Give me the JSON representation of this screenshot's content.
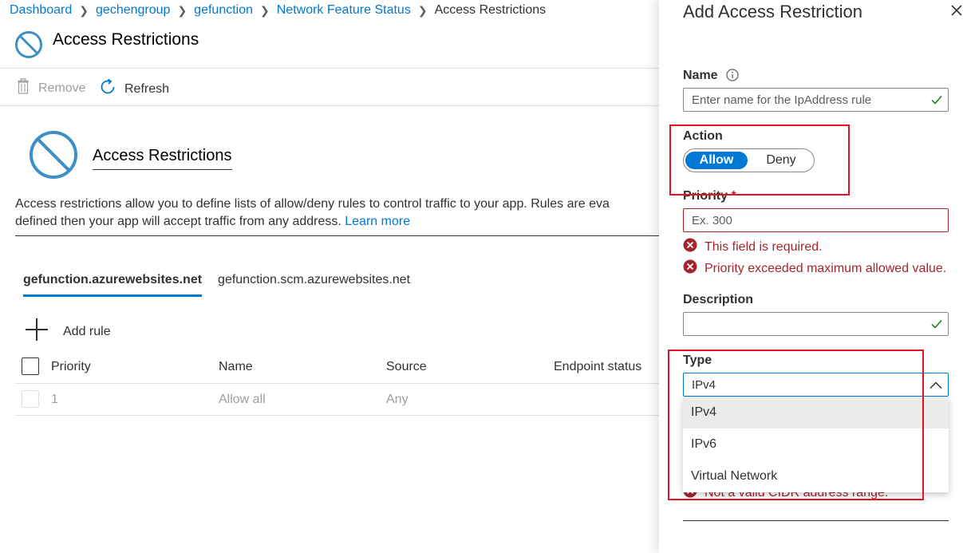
{
  "breadcrumb": {
    "items": [
      "Dashboard",
      "gechengroup",
      "gefunction",
      "Network Feature Status"
    ],
    "current": "Access Restrictions"
  },
  "page": {
    "title": "Access Restrictions"
  },
  "toolbar": {
    "remove_label": "Remove",
    "refresh_label": "Refresh"
  },
  "section": {
    "title": "Access Restrictions",
    "description_line1": "Access restrictions allow you to define lists of allow/deny rules to control traffic to your app. Rules are eva",
    "description_line2": "defined then your app will accept traffic from any address.",
    "learn_more": "Learn more"
  },
  "tabs": [
    {
      "label": "gefunction.azurewebsites.net",
      "active": true
    },
    {
      "label": "gefunction.scm.azurewebsites.net",
      "active": false
    }
  ],
  "add_rule_label": "Add rule",
  "table": {
    "columns": {
      "priority": "Priority",
      "name": "Name",
      "source": "Source",
      "endpoint": "Endpoint status"
    },
    "rows": [
      {
        "priority": "1",
        "name": "Allow all",
        "source": "Any"
      }
    ]
  },
  "panel": {
    "title": "Add Access Restriction",
    "name": {
      "label": "Name",
      "placeholder": "Enter name for the IpAddress rule",
      "value": ""
    },
    "action": {
      "label": "Action",
      "allow": "Allow",
      "deny": "Deny",
      "selected": "Allow"
    },
    "priority": {
      "label": "Priority",
      "required_mark": "*",
      "placeholder": "Ex. 300",
      "errors": [
        "This field is required.",
        "Priority exceeded maximum allowed value."
      ]
    },
    "description": {
      "label": "Description",
      "value": ""
    },
    "type": {
      "label": "Type",
      "selected": "IPv4",
      "options": [
        "IPv4",
        "IPv6",
        "Virtual Network"
      ],
      "hidden_error": "Not a valid CIDR address range."
    }
  },
  "colors": {
    "accent": "#0078d4",
    "error": "#a4262c",
    "success": "#107c10",
    "highlight": "#e81123"
  }
}
